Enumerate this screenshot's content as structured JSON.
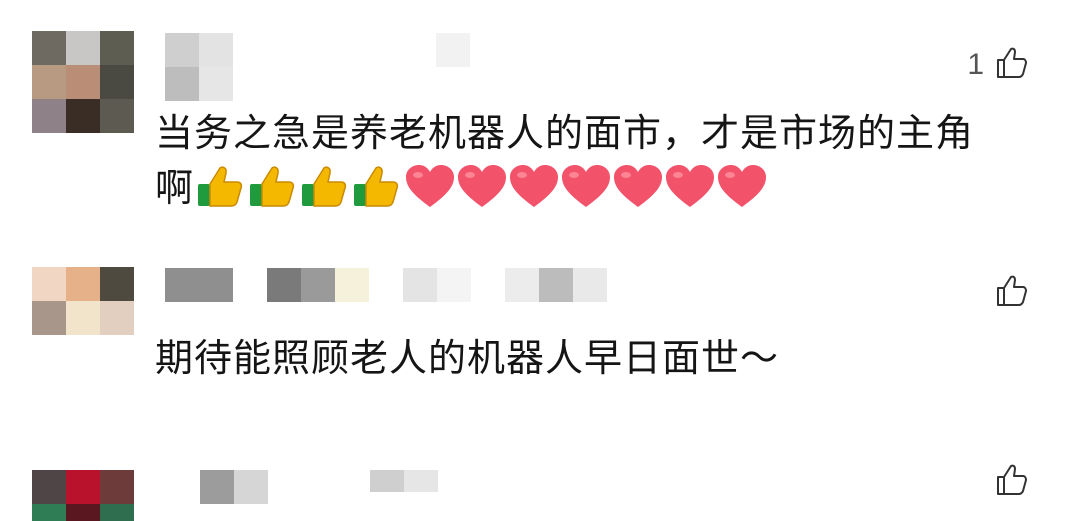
{
  "comments": [
    {
      "like_count": "1",
      "text_line1": "当务之急是养老机器人的面市，才是市场的主角",
      "text_line2": "啊",
      "emojis": [
        "thumbs-up",
        "thumbs-up",
        "thumbs-up",
        "thumbs-up",
        "heart",
        "heart",
        "heart",
        "heart",
        "heart",
        "heart",
        "heart"
      ]
    },
    {
      "like_count": "",
      "text_line1": "期待能照顾老人的机器人早日面世～"
    },
    {
      "like_count": ""
    }
  ],
  "colors": {
    "heart": "#f2536a",
    "thumb": "#f5b800",
    "cuff": "#1f9a3c"
  }
}
